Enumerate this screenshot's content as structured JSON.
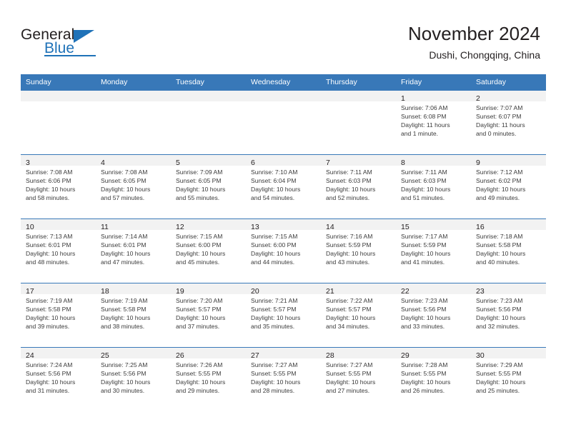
{
  "brand": {
    "name_part1": "General",
    "name_part2": "Blue",
    "accent_color": "#1f72b8"
  },
  "header": {
    "title": "November 2024",
    "subtitle": "Dushi, Chongqing, China"
  },
  "theme": {
    "header_row_bg": "#3878b8",
    "daynum_band_bg": "#f2f2f2",
    "grid_line": "#3878b8",
    "text": "#231f20"
  },
  "weekday_headers": [
    "Sunday",
    "Monday",
    "Tuesday",
    "Wednesday",
    "Thursday",
    "Friday",
    "Saturday"
  ],
  "weeks": [
    [
      {
        "day": "",
        "empty": true
      },
      {
        "day": "",
        "empty": true
      },
      {
        "day": "",
        "empty": true
      },
      {
        "day": "",
        "empty": true
      },
      {
        "day": "",
        "empty": true
      },
      {
        "day": "1",
        "sunrise": "Sunrise: 7:06 AM",
        "sunset": "Sunset: 6:08 PM",
        "daylight_line1": "Daylight: 11 hours",
        "daylight_line2": "and 1 minute."
      },
      {
        "day": "2",
        "sunrise": "Sunrise: 7:07 AM",
        "sunset": "Sunset: 6:07 PM",
        "daylight_line1": "Daylight: 11 hours",
        "daylight_line2": "and 0 minutes."
      }
    ],
    [
      {
        "day": "3",
        "sunrise": "Sunrise: 7:08 AM",
        "sunset": "Sunset: 6:06 PM",
        "daylight_line1": "Daylight: 10 hours",
        "daylight_line2": "and 58 minutes."
      },
      {
        "day": "4",
        "sunrise": "Sunrise: 7:08 AM",
        "sunset": "Sunset: 6:05 PM",
        "daylight_line1": "Daylight: 10 hours",
        "daylight_line2": "and 57 minutes."
      },
      {
        "day": "5",
        "sunrise": "Sunrise: 7:09 AM",
        "sunset": "Sunset: 6:05 PM",
        "daylight_line1": "Daylight: 10 hours",
        "daylight_line2": "and 55 minutes."
      },
      {
        "day": "6",
        "sunrise": "Sunrise: 7:10 AM",
        "sunset": "Sunset: 6:04 PM",
        "daylight_line1": "Daylight: 10 hours",
        "daylight_line2": "and 54 minutes."
      },
      {
        "day": "7",
        "sunrise": "Sunrise: 7:11 AM",
        "sunset": "Sunset: 6:03 PM",
        "daylight_line1": "Daylight: 10 hours",
        "daylight_line2": "and 52 minutes."
      },
      {
        "day": "8",
        "sunrise": "Sunrise: 7:11 AM",
        "sunset": "Sunset: 6:03 PM",
        "daylight_line1": "Daylight: 10 hours",
        "daylight_line2": "and 51 minutes."
      },
      {
        "day": "9",
        "sunrise": "Sunrise: 7:12 AM",
        "sunset": "Sunset: 6:02 PM",
        "daylight_line1": "Daylight: 10 hours",
        "daylight_line2": "and 49 minutes."
      }
    ],
    [
      {
        "day": "10",
        "sunrise": "Sunrise: 7:13 AM",
        "sunset": "Sunset: 6:01 PM",
        "daylight_line1": "Daylight: 10 hours",
        "daylight_line2": "and 48 minutes."
      },
      {
        "day": "11",
        "sunrise": "Sunrise: 7:14 AM",
        "sunset": "Sunset: 6:01 PM",
        "daylight_line1": "Daylight: 10 hours",
        "daylight_line2": "and 47 minutes."
      },
      {
        "day": "12",
        "sunrise": "Sunrise: 7:15 AM",
        "sunset": "Sunset: 6:00 PM",
        "daylight_line1": "Daylight: 10 hours",
        "daylight_line2": "and 45 minutes."
      },
      {
        "day": "13",
        "sunrise": "Sunrise: 7:15 AM",
        "sunset": "Sunset: 6:00 PM",
        "daylight_line1": "Daylight: 10 hours",
        "daylight_line2": "and 44 minutes."
      },
      {
        "day": "14",
        "sunrise": "Sunrise: 7:16 AM",
        "sunset": "Sunset: 5:59 PM",
        "daylight_line1": "Daylight: 10 hours",
        "daylight_line2": "and 43 minutes."
      },
      {
        "day": "15",
        "sunrise": "Sunrise: 7:17 AM",
        "sunset": "Sunset: 5:59 PM",
        "daylight_line1": "Daylight: 10 hours",
        "daylight_line2": "and 41 minutes."
      },
      {
        "day": "16",
        "sunrise": "Sunrise: 7:18 AM",
        "sunset": "Sunset: 5:58 PM",
        "daylight_line1": "Daylight: 10 hours",
        "daylight_line2": "and 40 minutes."
      }
    ],
    [
      {
        "day": "17",
        "sunrise": "Sunrise: 7:19 AM",
        "sunset": "Sunset: 5:58 PM",
        "daylight_line1": "Daylight: 10 hours",
        "daylight_line2": "and 39 minutes."
      },
      {
        "day": "18",
        "sunrise": "Sunrise: 7:19 AM",
        "sunset": "Sunset: 5:58 PM",
        "daylight_line1": "Daylight: 10 hours",
        "daylight_line2": "and 38 minutes."
      },
      {
        "day": "19",
        "sunrise": "Sunrise: 7:20 AM",
        "sunset": "Sunset: 5:57 PM",
        "daylight_line1": "Daylight: 10 hours",
        "daylight_line2": "and 37 minutes."
      },
      {
        "day": "20",
        "sunrise": "Sunrise: 7:21 AM",
        "sunset": "Sunset: 5:57 PM",
        "daylight_line1": "Daylight: 10 hours",
        "daylight_line2": "and 35 minutes."
      },
      {
        "day": "21",
        "sunrise": "Sunrise: 7:22 AM",
        "sunset": "Sunset: 5:57 PM",
        "daylight_line1": "Daylight: 10 hours",
        "daylight_line2": "and 34 minutes."
      },
      {
        "day": "22",
        "sunrise": "Sunrise: 7:23 AM",
        "sunset": "Sunset: 5:56 PM",
        "daylight_line1": "Daylight: 10 hours",
        "daylight_line2": "and 33 minutes."
      },
      {
        "day": "23",
        "sunrise": "Sunrise: 7:23 AM",
        "sunset": "Sunset: 5:56 PM",
        "daylight_line1": "Daylight: 10 hours",
        "daylight_line2": "and 32 minutes."
      }
    ],
    [
      {
        "day": "24",
        "sunrise": "Sunrise: 7:24 AM",
        "sunset": "Sunset: 5:56 PM",
        "daylight_line1": "Daylight: 10 hours",
        "daylight_line2": "and 31 minutes."
      },
      {
        "day": "25",
        "sunrise": "Sunrise: 7:25 AM",
        "sunset": "Sunset: 5:56 PM",
        "daylight_line1": "Daylight: 10 hours",
        "daylight_line2": "and 30 minutes."
      },
      {
        "day": "26",
        "sunrise": "Sunrise: 7:26 AM",
        "sunset": "Sunset: 5:55 PM",
        "daylight_line1": "Daylight: 10 hours",
        "daylight_line2": "and 29 minutes."
      },
      {
        "day": "27",
        "sunrise": "Sunrise: 7:27 AM",
        "sunset": "Sunset: 5:55 PM",
        "daylight_line1": "Daylight: 10 hours",
        "daylight_line2": "and 28 minutes."
      },
      {
        "day": "28",
        "sunrise": "Sunrise: 7:27 AM",
        "sunset": "Sunset: 5:55 PM",
        "daylight_line1": "Daylight: 10 hours",
        "daylight_line2": "and 27 minutes."
      },
      {
        "day": "29",
        "sunrise": "Sunrise: 7:28 AM",
        "sunset": "Sunset: 5:55 PM",
        "daylight_line1": "Daylight: 10 hours",
        "daylight_line2": "and 26 minutes."
      },
      {
        "day": "30",
        "sunrise": "Sunrise: 7:29 AM",
        "sunset": "Sunset: 5:55 PM",
        "daylight_line1": "Daylight: 10 hours",
        "daylight_line2": "and 25 minutes."
      }
    ]
  ]
}
